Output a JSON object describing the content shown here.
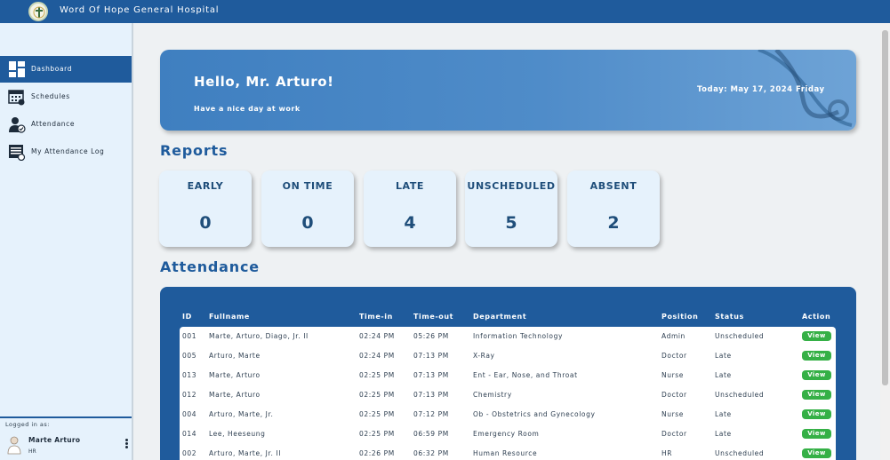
{
  "app": {
    "title": "Word Of Hope General Hospital"
  },
  "sidebar": {
    "items": [
      {
        "label": "Dashboard",
        "icon": "dashboard-icon",
        "active": true
      },
      {
        "label": "Schedules",
        "icon": "calendar-icon"
      },
      {
        "label": "Attendance",
        "icon": "attendance-user-icon"
      },
      {
        "label": "My Attendance Log",
        "icon": "log-icon"
      }
    ],
    "logged_in_label": "Logged in as:",
    "user": {
      "name": "Marte Arturo",
      "role": "HR"
    }
  },
  "hero": {
    "greeting": "Hello, Mr. Arturo!",
    "subtitle": "Have a nice day at work",
    "date": "Today: May 17, 2024 Friday"
  },
  "reports": {
    "title": "Reports",
    "cards": [
      {
        "label": "EARLY",
        "value": "0"
      },
      {
        "label": "ON TIME",
        "value": "0"
      },
      {
        "label": "LATE",
        "value": "4"
      },
      {
        "label": "UNSCHEDULED",
        "value": "5"
      },
      {
        "label": "ABSENT",
        "value": "2"
      }
    ]
  },
  "attendance": {
    "title": "Attendance",
    "columns": [
      "ID",
      "Fullname",
      "Time-in",
      "Time-out",
      "Department",
      "Position",
      "Status",
      "Action"
    ],
    "rows": [
      {
        "id": "001",
        "fullname": "Marte, Arturo, Diago, Jr. II",
        "time_in": "02:24 PM",
        "time_out": "05:26 PM",
        "department": "Information Technology",
        "position": "Admin",
        "status": "Unscheduled",
        "action": "View"
      },
      {
        "id": "005",
        "fullname": "Arturo, Marte",
        "time_in": "02:24 PM",
        "time_out": "07:13 PM",
        "department": "X-Ray",
        "position": "Doctor",
        "status": "Late",
        "action": "View"
      },
      {
        "id": "013",
        "fullname": "Marte, Arturo",
        "time_in": "02:25 PM",
        "time_out": "07:13 PM",
        "department": "Ent - Ear, Nose, and Throat",
        "position": "Nurse",
        "status": "Late",
        "action": "View"
      },
      {
        "id": "012",
        "fullname": "Marte, Arturo",
        "time_in": "02:25 PM",
        "time_out": "07:13 PM",
        "department": "Chemistry",
        "position": "Doctor",
        "status": "Unscheduled",
        "action": "View"
      },
      {
        "id": "004",
        "fullname": "Arturo, Marte, Jr.",
        "time_in": "02:25 PM",
        "time_out": "07:12 PM",
        "department": "Ob - Obstetrics and Gynecology",
        "position": "Nurse",
        "status": "Late",
        "action": "View"
      },
      {
        "id": "014",
        "fullname": "Lee, Heeseung",
        "time_in": "02:25 PM",
        "time_out": "06:59 PM",
        "department": "Emergency Room",
        "position": "Doctor",
        "status": "Late",
        "action": "View"
      },
      {
        "id": "002",
        "fullname": "Arturo, Marte, Jr. II",
        "time_in": "02:26 PM",
        "time_out": "06:32 PM",
        "department": "Human Resource",
        "position": "HR",
        "status": "Unscheduled",
        "action": "View"
      }
    ]
  },
  "colors": {
    "brand": "#1f5b9c",
    "sidebar_bg": "#e6f2fc",
    "view_button": "#35b046"
  }
}
